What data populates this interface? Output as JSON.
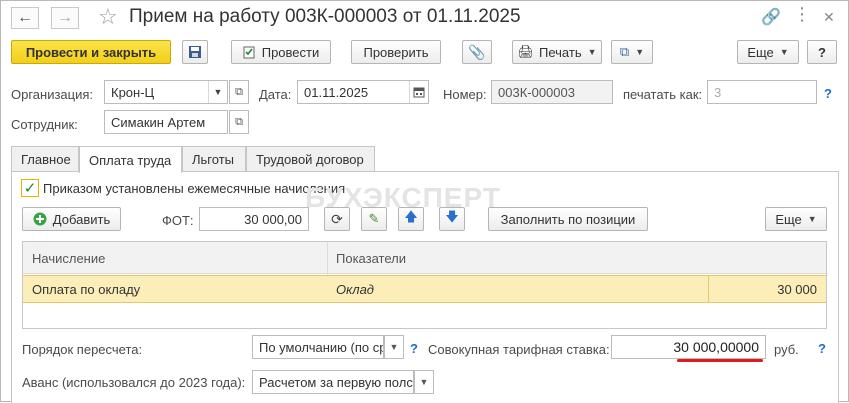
{
  "window": {
    "title": "Прием на работу 003К-000003 от 01.11.2025"
  },
  "toolbar": {
    "post_close_label": "Провести и закрыть",
    "post_label": "Провести",
    "check_label": "Проверить",
    "print_label": "Печать",
    "more_label": "Еще",
    "help_label": "?"
  },
  "header": {
    "org_label": "Организация:",
    "org_value": "Крон-Ц",
    "date_label": "Дата:",
    "date_value": "01.11.2025",
    "number_label": "Номер:",
    "number_value": "003К-000003",
    "print_as_label": "печатать как:",
    "print_as_value": "3",
    "employee_label": "Сотрудник:",
    "employee_value": "Симакин Артем"
  },
  "tabs": [
    {
      "label": "Главное"
    },
    {
      "label": "Оплата труда"
    },
    {
      "label": "Льготы"
    },
    {
      "label": "Трудовой договор"
    }
  ],
  "pay": {
    "monthly_checkbox_label": "Приказом установлены ежемесячные начисления",
    "watermark": "БУХЭКСПЕРТ",
    "add_label": "Добавить",
    "fot_label": "ФОТ:",
    "fot_value": "30 000,00",
    "fill_label": "Заполнить по позиции",
    "more_label": "Еще",
    "table": {
      "col_accrual": "Начисление",
      "col_indicators": "Показатели",
      "rows": [
        {
          "accrual": "Оплата по окладу",
          "indicator": "Оклад",
          "value": "30 000"
        }
      ]
    },
    "recalc_label": "Порядок пересчета:",
    "recalc_value": "По умолчанию (по ср",
    "tariff_label": "Совокупная тарифная ставка:",
    "tariff_value": "30 000,00000",
    "tariff_unit": "руб.",
    "advance_label": "Аванс (использовался до 2023 года):",
    "advance_value": "Расчетом за первую полс"
  },
  "colors": {
    "primary_button": "#f5d42a",
    "selected_row": "#fbeeb9",
    "help_blue": "#1d6fc7",
    "highlight_red": "#e01b1b"
  }
}
